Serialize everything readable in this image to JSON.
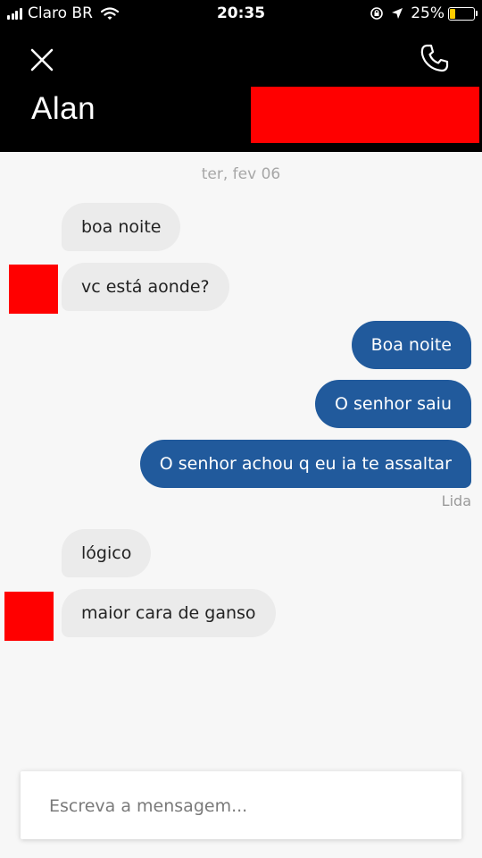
{
  "status_bar": {
    "carrier": "Claro BR",
    "time": "20:35",
    "battery": "25%",
    "battery_level": 0.25,
    "icons": [
      "signal-icon",
      "wifi-icon",
      "orientation-lock-icon",
      "location-icon",
      "battery-icon"
    ]
  },
  "header": {
    "contact_name": "Alan",
    "icons": [
      "close-icon",
      "phone-icon"
    ]
  },
  "conversation": {
    "date": "ter, fev 06",
    "messages": [
      {
        "direction": "in",
        "text": "boa noite"
      },
      {
        "direction": "in",
        "text": "vc está aonde?"
      },
      {
        "direction": "out",
        "text": "Boa noite"
      },
      {
        "direction": "out",
        "text": "O senhor saiu"
      },
      {
        "direction": "out",
        "text": "O senhor achou q eu ia te assaltar"
      },
      {
        "direction": "in",
        "text": "lógico"
      },
      {
        "direction": "in",
        "text": "maior cara de ganso"
      }
    ],
    "read_receipt": "Lida"
  },
  "composer": {
    "placeholder": "Escreva a mensagem..."
  },
  "colors": {
    "outgoing_bubble": "#215a9c",
    "incoming_bubble": "#ebebeb",
    "header_background": "#000000",
    "redaction": "#ff0000",
    "battery_fill": "#ffcc00"
  }
}
